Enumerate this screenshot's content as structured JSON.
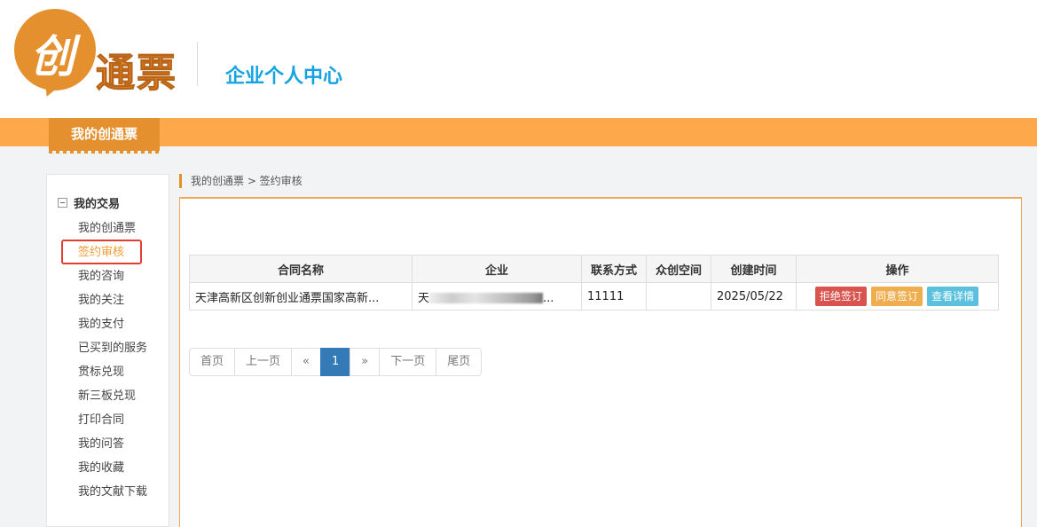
{
  "header": {
    "logo_char": "创",
    "logo_text": "通票",
    "subtitle": "企业个人中心"
  },
  "nav": {
    "tab_label": "我的创通票"
  },
  "sidebar": {
    "title": "我的交易",
    "items": [
      {
        "label": "我的创通票"
      },
      {
        "label": "签约审核"
      },
      {
        "label": "我的咨询"
      },
      {
        "label": "我的关注"
      },
      {
        "label": "我的支付"
      },
      {
        "label": "已买到的服务"
      },
      {
        "label": "贯标兑现"
      },
      {
        "label": "新三板兑现"
      },
      {
        "label": "打印合同"
      },
      {
        "label": "我的问答"
      },
      {
        "label": "我的收藏"
      },
      {
        "label": "我的文献下载"
      }
    ],
    "active_index": 1
  },
  "breadcrumb": {
    "text": "我的创通票 > 签约审核"
  },
  "table": {
    "headers": [
      "合同名称",
      "企业",
      "联系方式",
      "众创空间",
      "创建时间",
      "操作"
    ],
    "rows": [
      {
        "contract_name": "天津高新区创新创业通票国家高新...",
        "company_prefix": "天",
        "company_suffix": "...",
        "contact": "11111",
        "space": "",
        "created": "2025/05/22"
      }
    ],
    "actions": {
      "reject": "拒绝签订",
      "agree": "同意签订",
      "detail": "查看详情"
    }
  },
  "pagination": {
    "first": "首页",
    "prev": "上一页",
    "prev_arrow": "«",
    "current": "1",
    "next_arrow": "»",
    "next": "下一页",
    "last": "尾页"
  },
  "colors": {
    "brand_orange": "#e5902e",
    "nav_bar": "#fda84a",
    "subtitle_blue": "#12a3e0",
    "active_link": "#f39c35",
    "highlight_box": "#e53d2f"
  }
}
